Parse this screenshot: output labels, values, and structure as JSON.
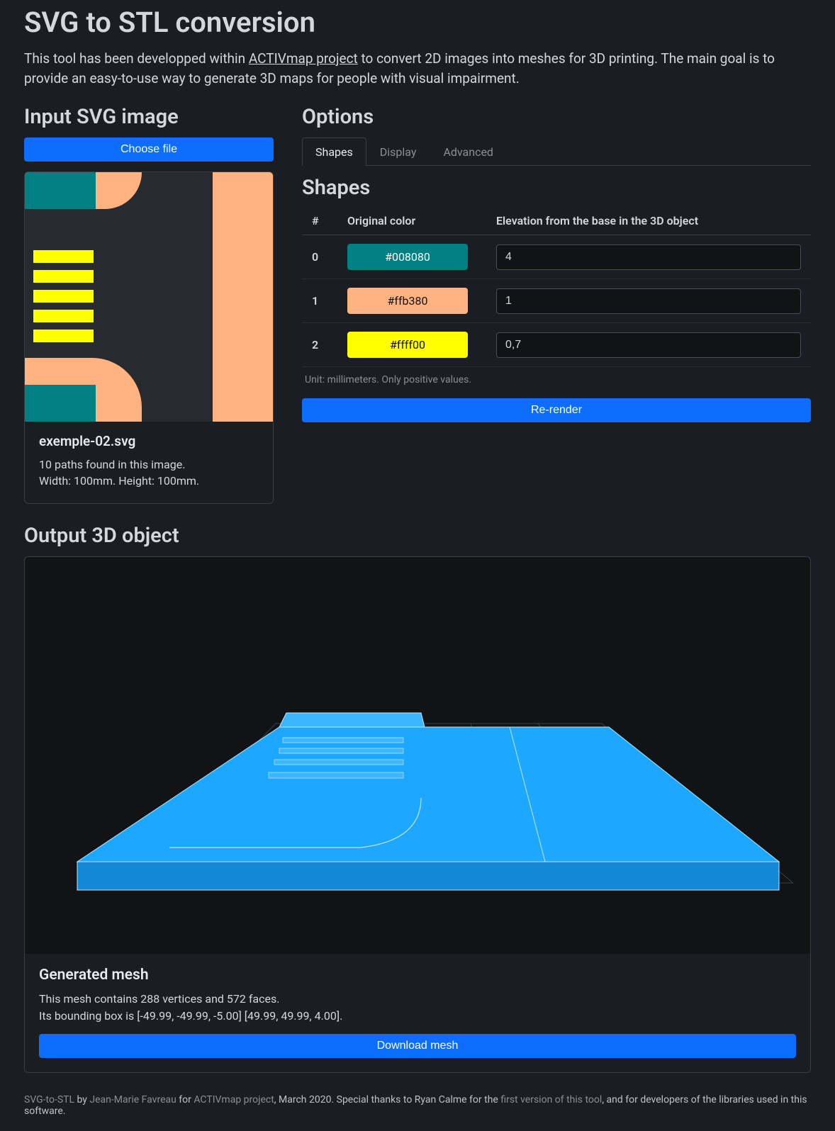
{
  "page": {
    "title": "SVG to STL conversion",
    "lead_before": "This tool has been developped within ",
    "lead_link": "ACTIVmap project",
    "lead_after": " to convert 2D images into meshes for 3D printing. The main goal is to provide an easy-to-use way to generate 3D maps for people with visual impairment."
  },
  "input": {
    "heading": "Input SVG image",
    "choose_button": "Choose file",
    "filename": "exemple-02.svg",
    "paths_found": "10 paths found in this image.",
    "dimensions": "Width: 100mm. Height: 100mm."
  },
  "options": {
    "heading": "Options",
    "tabs": {
      "shapes": "Shapes",
      "display": "Display",
      "advanced": "Advanced"
    },
    "shapes_heading": "Shapes",
    "table": {
      "col_index": "#",
      "col_color": "Original color",
      "col_elev": "Elevation from the base in the 3D object",
      "rows": [
        {
          "index": "0",
          "color_hex": "#008080",
          "color_bg": "#008080",
          "color_text": "#ffffff",
          "elevation": "4"
        },
        {
          "index": "1",
          "color_hex": "#ffb380",
          "color_bg": "#ffb380",
          "color_text": "#111111",
          "elevation": "1"
        },
        {
          "index": "2",
          "color_hex": "#ffff00",
          "color_bg": "#ffff00",
          "color_text": "#111111",
          "elevation": "0,7"
        }
      ]
    },
    "unit_note": "Unit: millimeters. Only positive values.",
    "rerender": "Re-render"
  },
  "output": {
    "heading": "Output 3D object",
    "mesh_title": "Generated mesh",
    "mesh_line1": "This mesh contains 288 vertices and 572 faces.",
    "mesh_line2": "Its bounding box is [-49.99, -49.99, -5.00] [49.99, 49.99, 4.00].",
    "download": "Download mesh"
  },
  "footer": {
    "link1": "SVG-to-STL",
    "by": " by ",
    "link2": "Jean-Marie Favreau",
    "for": " for ",
    "link3": "ACTIVmap project",
    "mid": ", March 2020. Special thanks to Ryan Calme for the ",
    "link4": "first version of this tool",
    "end": ", and for developers of the libraries used in this software."
  },
  "colors": {
    "teal": "#008080",
    "peach": "#ffb380",
    "yellow": "#ffff00",
    "mesh_blue": "#1ea7ff"
  }
}
